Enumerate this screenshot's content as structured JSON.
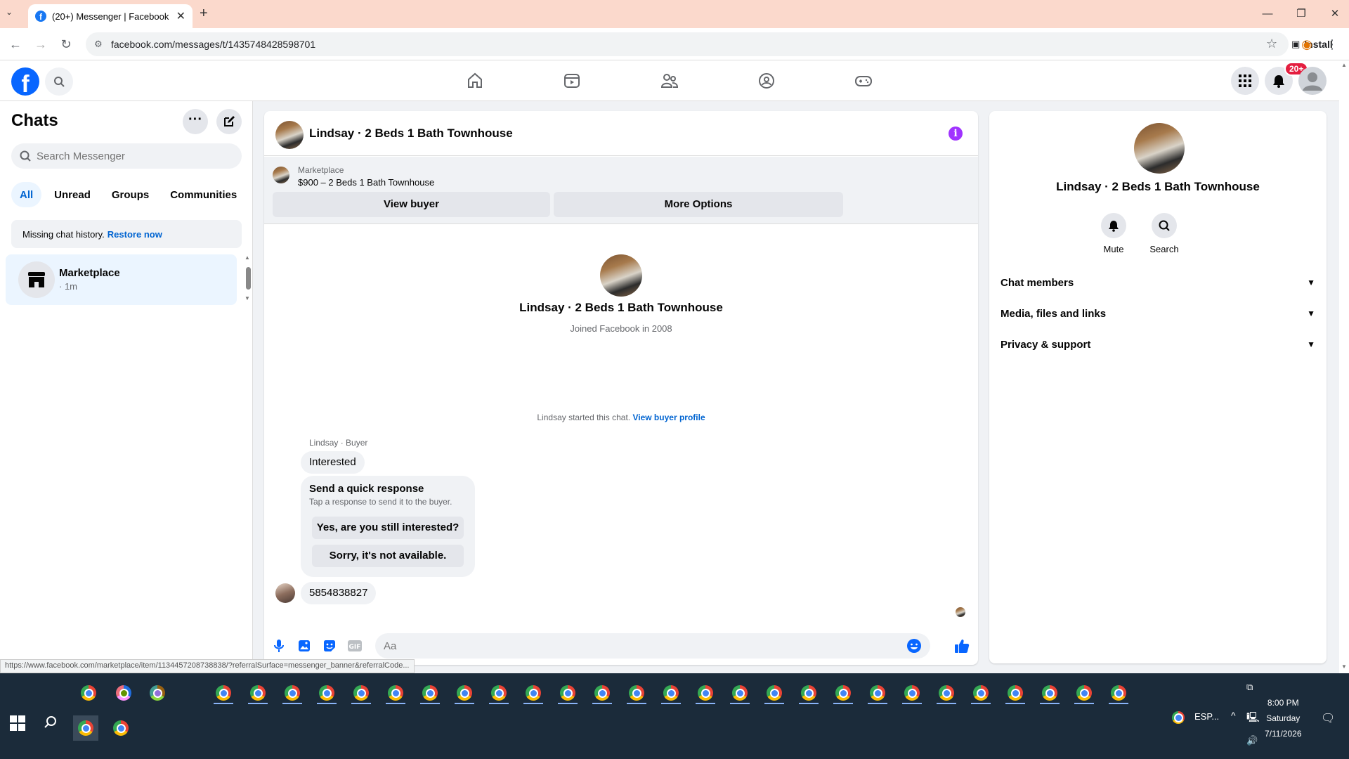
{
  "browser": {
    "tab_title": "(20+) Messenger | Facebook",
    "url": "facebook.com/messages/t/1435748428598701",
    "install_label": "Install",
    "status_url": "https://www.facebook.com/marketplace/item/1134457208738838/?referralSurface=messenger_banner&referralCode..."
  },
  "header": {
    "notification_badge": "20+"
  },
  "sidebar": {
    "title": "Chats",
    "search_placeholder": "Search Messenger",
    "filters": [
      "All",
      "Unread",
      "Groups",
      "Communities"
    ],
    "missing_history": "Missing chat history.",
    "restore_link": "Restore now",
    "chat": {
      "name": "Marketplace",
      "meta": "· 1m"
    }
  },
  "conversation": {
    "title": "Lindsay · 2 Beds 1 Bath Townhouse",
    "banner_label": "Marketplace",
    "banner_price": "$900 – 2 Beds 1 Bath Townhouse",
    "view_buyer": "View buyer",
    "more_options": "More Options",
    "intro_name": "Lindsay · 2 Beds 1 Bath Townhouse",
    "intro_joined": "Joined Facebook in 2008",
    "started_text": "Lindsay started this chat.",
    "started_link": "View buyer profile",
    "sender_label": "Lindsay · Buyer",
    "message1": "Interested",
    "quick_title": "Send a quick response",
    "quick_sub": "Tap a response to send it to the buyer.",
    "quick_1": "Yes, are you still interested?",
    "quick_2": "Sorry, it's not available.",
    "message2": "5854838827",
    "composer_placeholder": "Aa"
  },
  "details": {
    "name": "Lindsay · 2 Beds 1 Bath Townhouse",
    "mute": "Mute",
    "search": "Search",
    "sections": [
      "Chat members",
      "Media, files and links",
      "Privacy & support"
    ]
  },
  "taskbar": {
    "time": "8:00 PM",
    "day": "Saturday",
    "date": "7/11/2026",
    "lang": "ESP..."
  },
  "colors": {
    "fb_blue": "#0866ff",
    "link_blue": "#0064d1",
    "info_purple": "#a033ff",
    "titlebar": "#fbd9cc"
  }
}
